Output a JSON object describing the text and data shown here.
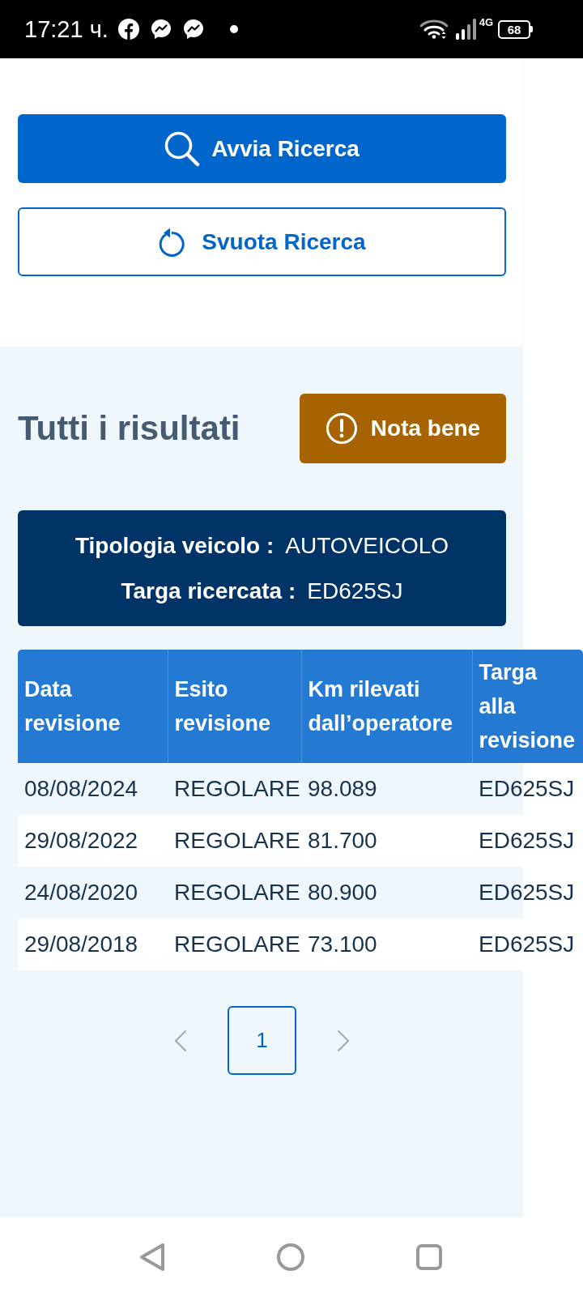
{
  "status_bar": {
    "time": "17:21 ч.",
    "network": "4G",
    "battery": "68"
  },
  "actions": [
    {
      "kind": "primary",
      "label": "Avvia Ricerca"
    },
    {
      "kind": "secondary",
      "label": "Svuota Ricerca"
    }
  ],
  "results": {
    "title": "Tutti i risultati",
    "notice_button": "Nota bene",
    "summary": [
      {
        "label": "Tipologia veicolo :",
        "value": "AUTOVEICOLO"
      },
      {
        "label": "Targa ricercata :",
        "value": "ED625SJ"
      }
    ],
    "table": {
      "columns": [
        "Data revisione",
        "Esito revisione",
        "Km rilevati dall’operatore",
        "Targa alla revisione"
      ],
      "rows": [
        [
          "08/08/2024",
          "REGOLARE",
          "98.089",
          "ED625SJ"
        ],
        [
          "29/08/2022",
          "REGOLARE",
          "81.700",
          "ED625SJ"
        ],
        [
          "24/08/2020",
          "REGOLARE",
          "80.900",
          "ED625SJ"
        ],
        [
          "29/08/2018",
          "REGOLARE",
          "73.100",
          "ED625SJ"
        ]
      ]
    },
    "pagination": {
      "previous": {
        "disabled": true
      },
      "pages": [
        {
          "label": "1",
          "selected": true
        }
      ],
      "next": {
        "disabled": true
      }
    }
  }
}
